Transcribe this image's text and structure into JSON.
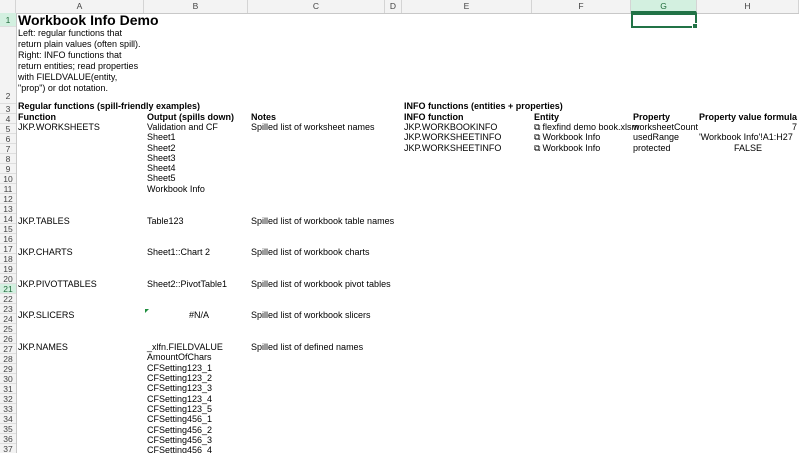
{
  "columns": [
    "A",
    "B",
    "C",
    "D",
    "E",
    "F",
    "G",
    "H"
  ],
  "rows": [
    "1",
    "2",
    "3",
    "4",
    "5",
    "6",
    "7",
    "8",
    "9",
    "10",
    "11",
    "12",
    "13",
    "14",
    "15",
    "16",
    "17",
    "18",
    "19",
    "20",
    "21",
    "22",
    "23",
    "24",
    "25",
    "26",
    "27",
    "28",
    "29",
    "30",
    "31",
    "32",
    "33",
    "34",
    "35",
    "36",
    "37"
  ],
  "title": "Workbook Info Demo",
  "description": "Left: regular functions that return plain values (often spill). Right: INFO functions that return entities; read properties with FIELDVALUE(entity, \"prop\") or dot notation.",
  "left_section": {
    "heading": "Regular functions (spill-friendly examples)",
    "col_function": "Function",
    "col_output": "Output (spills down)",
    "col_notes": "Notes",
    "worksheets": {
      "fn": "JKP.WORKSHEETS",
      "outputs": [
        "Validation and CF",
        "Sheet1",
        "Sheet2",
        "Sheet3",
        "Sheet4",
        "Sheet5",
        "Workbook Info"
      ],
      "note": "Spilled list of worksheet names"
    },
    "tables": {
      "fn": "JKP.TABLES",
      "output": "Table123",
      "note": "Spilled list of workbook table names"
    },
    "charts": {
      "fn": "JKP.CHARTS",
      "output": "Sheet1::Chart 2",
      "note": "Spilled list of workbook charts"
    },
    "pivottables": {
      "fn": "JKP.PIVOTTABLES",
      "output": "Sheet2::PivotTable1",
      "note": "Spilled list of workbook pivot tables"
    },
    "slicers": {
      "fn": "JKP.SLICERS",
      "output": "#N/A",
      "note": "Spilled list of workbook slicers"
    },
    "names": {
      "fn": "JKP.NAMES",
      "outputs": [
        "_xlfn.FIELDVALUE",
        "AmountOfChars",
        "CFSetting123_1",
        "CFSetting123_2",
        "CFSetting123_3",
        "CFSetting123_4",
        "CFSetting123_5",
        "CFSetting456_1",
        "CFSetting456_2",
        "CFSetting456_3",
        "CFSetting456_4"
      ],
      "note": "Spilled list of defined names"
    }
  },
  "right_section": {
    "heading": "INFO functions (entities + properties)",
    "col_function": "INFO function",
    "col_entity": "Entity",
    "col_property": "Property",
    "col_value": "Property value formula",
    "rows": [
      {
        "fn": "JKP.WORKBOOKINFO",
        "entity": "flexfind demo book.xlsm",
        "property": "worksheetCount",
        "value": "7"
      },
      {
        "fn": "JKP.WORKSHEETINFO",
        "entity": "Workbook Info",
        "property": "usedRange",
        "value": "'Workbook Info'!A1:H27"
      },
      {
        "fn": "JKP.WORKSHEETINFO",
        "entity": "Workbook Info",
        "property": "protected",
        "value": "FALSE"
      }
    ]
  },
  "entity_icon": "entity-layers-icon",
  "selected_cell": "G1",
  "colors": {
    "selection": "#217346",
    "header_bg": "#f3f3f3",
    "selected_header_bg": "#d3f0e0"
  }
}
